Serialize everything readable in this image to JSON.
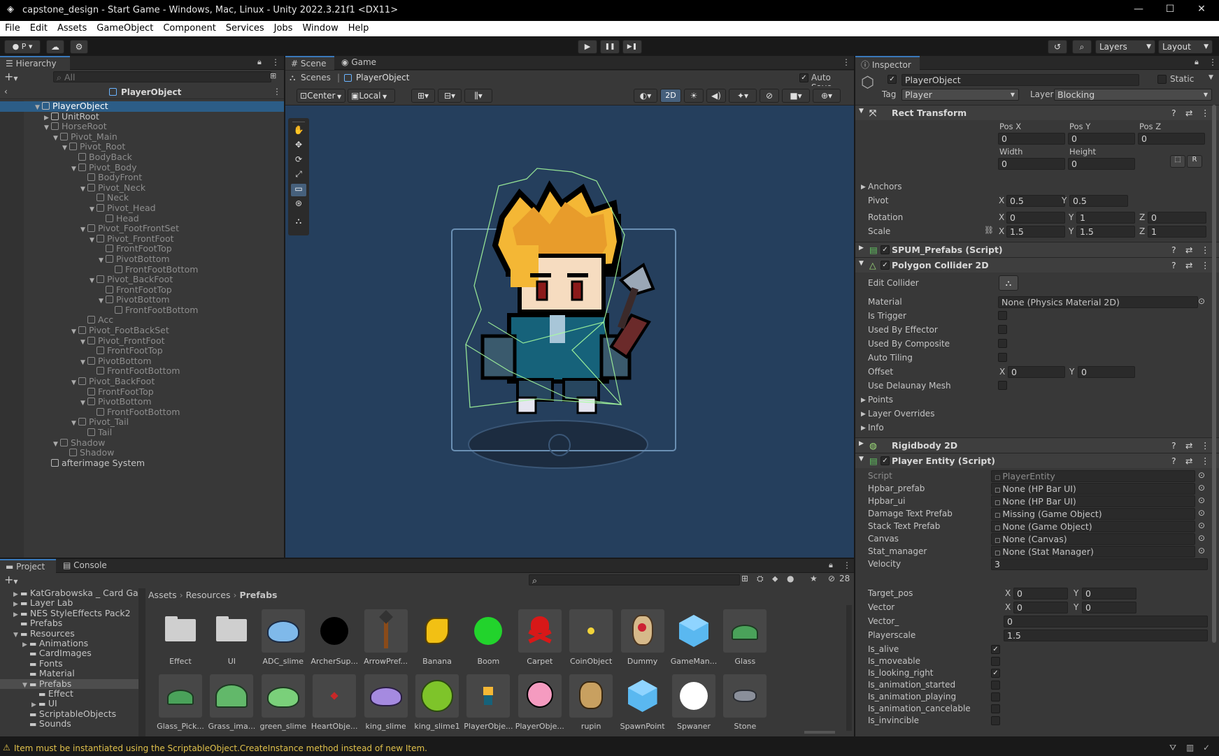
{
  "window": {
    "title": "capstone_design - Start Game - Windows, Mac, Linux - Unity 2022.3.21f1 <DX11>",
    "min": "—",
    "max": "☐",
    "close": "✕"
  },
  "menu": [
    "File",
    "Edit",
    "Assets",
    "GameObject",
    "Component",
    "Services",
    "Jobs",
    "Window",
    "Help"
  ],
  "toolbar": {
    "account": "P ▾",
    "play": "▶",
    "pause": "❚❚",
    "step": "▶❚",
    "layers": "Layers",
    "layout": "Layout"
  },
  "hierarchy": {
    "tab": "Hierarchy",
    "search_placeholder": "All",
    "breadcrumb": "PlayerObject",
    "rows": [
      {
        "label": "PlayerObject",
        "depth": 0,
        "arrow": "▼",
        "selected": true,
        "dim": false
      },
      {
        "label": "UnitRoot",
        "depth": 1,
        "arrow": "▶",
        "selected": false,
        "dim": false
      },
      {
        "label": "HorseRoot",
        "depth": 1,
        "arrow": "▼",
        "selected": false,
        "dim": true
      },
      {
        "label": "Pivot_Main",
        "depth": 2,
        "arrow": "▼",
        "selected": false,
        "dim": true
      },
      {
        "label": "Pivot_Root",
        "depth": 3,
        "arrow": "▼",
        "selected": false,
        "dim": true
      },
      {
        "label": "BodyBack",
        "depth": 4,
        "arrow": "",
        "selected": false,
        "dim": true
      },
      {
        "label": "Pivot_Body",
        "depth": 4,
        "arrow": "▼",
        "selected": false,
        "dim": true
      },
      {
        "label": "BodyFront",
        "depth": 5,
        "arrow": "",
        "selected": false,
        "dim": true
      },
      {
        "label": "Pivot_Neck",
        "depth": 5,
        "arrow": "▼",
        "selected": false,
        "dim": true
      },
      {
        "label": "Neck",
        "depth": 6,
        "arrow": "",
        "selected": false,
        "dim": true
      },
      {
        "label": "Pivot_Head",
        "depth": 6,
        "arrow": "▼",
        "selected": false,
        "dim": true
      },
      {
        "label": "Head",
        "depth": 7,
        "arrow": "",
        "selected": false,
        "dim": true
      },
      {
        "label": "Pivot_FootFrontSet",
        "depth": 5,
        "arrow": "▼",
        "selected": false,
        "dim": true
      },
      {
        "label": "Pivot_FrontFoot",
        "depth": 6,
        "arrow": "▼",
        "selected": false,
        "dim": true
      },
      {
        "label": "FrontFootTop",
        "depth": 7,
        "arrow": "",
        "selected": false,
        "dim": true
      },
      {
        "label": "PivotBottom",
        "depth": 7,
        "arrow": "▼",
        "selected": false,
        "dim": true
      },
      {
        "label": "FrontFootBottom",
        "depth": 8,
        "arrow": "",
        "selected": false,
        "dim": true
      },
      {
        "label": "Pivot_BackFoot",
        "depth": 6,
        "arrow": "▼",
        "selected": false,
        "dim": true
      },
      {
        "label": "FrontFootTop",
        "depth": 7,
        "arrow": "",
        "selected": false,
        "dim": true
      },
      {
        "label": "PivotBottom",
        "depth": 7,
        "arrow": "▼",
        "selected": false,
        "dim": true
      },
      {
        "label": "FrontFootBottom",
        "depth": 8,
        "arrow": "",
        "selected": false,
        "dim": true
      },
      {
        "label": "Acc",
        "depth": 5,
        "arrow": "",
        "selected": false,
        "dim": true
      },
      {
        "label": "Pivot_FootBackSet",
        "depth": 4,
        "arrow": "▼",
        "selected": false,
        "dim": true
      },
      {
        "label": "Pivot_FrontFoot",
        "depth": 5,
        "arrow": "▼",
        "selected": false,
        "dim": true
      },
      {
        "label": "FrontFootTop",
        "depth": 6,
        "arrow": "",
        "selected": false,
        "dim": true
      },
      {
        "label": "PivotBottom",
        "depth": 5,
        "arrow": "▼",
        "selected": false,
        "dim": true
      },
      {
        "label": "FrontFootBottom",
        "depth": 6,
        "arrow": "",
        "selected": false,
        "dim": true
      },
      {
        "label": "Pivot_BackFoot",
        "depth": 4,
        "arrow": "▼",
        "selected": false,
        "dim": true
      },
      {
        "label": "FrontFootTop",
        "depth": 5,
        "arrow": "",
        "selected": false,
        "dim": true
      },
      {
        "label": "PivotBottom",
        "depth": 5,
        "arrow": "▼",
        "selected": false,
        "dim": true
      },
      {
        "label": "FrontFootBottom",
        "depth": 6,
        "arrow": "",
        "selected": false,
        "dim": true
      },
      {
        "label": "Pivot_Tail",
        "depth": 4,
        "arrow": "▼",
        "selected": false,
        "dim": true
      },
      {
        "label": "Tail",
        "depth": 5,
        "arrow": "",
        "selected": false,
        "dim": true
      },
      {
        "label": "Shadow",
        "depth": 2,
        "arrow": "▼",
        "selected": false,
        "dim": true
      },
      {
        "label": "Shadow",
        "depth": 3,
        "arrow": "",
        "selected": false,
        "dim": true
      },
      {
        "label": "afterimage System",
        "depth": 1,
        "arrow": "",
        "selected": false,
        "dim": false
      }
    ]
  },
  "scene": {
    "tab_scene": "Scene",
    "tab_game": "Game",
    "crumb_scenes": "Scenes",
    "crumb_obj": "PlayerObject",
    "autosave": "Auto Save",
    "pivot": "Center",
    "space": "Local",
    "mode2d": "2D"
  },
  "inspector": {
    "tab": "Inspector",
    "object_name": "PlayerObject",
    "static": "Static",
    "tag_label": "Tag",
    "tag": "Player",
    "layer_label": "Layer",
    "layer": "Blocking",
    "rect": {
      "title": "Rect Transform",
      "posx_l": "Pos X",
      "posy_l": "Pos Y",
      "posz_l": "Pos Z",
      "posx": "0",
      "posy": "0",
      "posz": "0",
      "width_l": "Width",
      "height_l": "Height",
      "width": "0",
      "height": "0",
      "r": "R",
      "anchors": "Anchors",
      "pivot": "Pivot",
      "pivot_x": "0.5",
      "pivot_y": "0.5",
      "rotation": "Rotation",
      "rot_x": "0",
      "rot_y": "1",
      "rot_z": "0",
      "scale": "Scale",
      "sc_x": "1.5",
      "sc_y": "1.5",
      "sc_z": "1",
      "x": "X",
      "y": "Y",
      "z": "Z"
    },
    "spum": "SPUM_Prefabs (Script)",
    "poly": {
      "title": "Polygon Collider 2D",
      "edit": "Edit Collider",
      "material_l": "Material",
      "material": "None (Physics Material 2D)",
      "is_trigger": "Is Trigger",
      "effector": "Used By Effector",
      "composite": "Used By Composite",
      "tiling": "Auto Tiling",
      "offset": "Offset",
      "off_x": "0",
      "off_y": "0",
      "delaunay": "Use Delaunay Mesh",
      "points": "Points",
      "layer_over": "Layer Overrides",
      "info": "Info"
    },
    "rigid": "Rigidbody 2D",
    "player": {
      "title": "Player Entity (Script)",
      "fields": [
        {
          "label": "Script",
          "value": "PlayerEntity",
          "kind": "obj",
          "dim": true
        },
        {
          "label": "Hpbar_prefab",
          "value": "None (HP Bar UI)",
          "kind": "obj",
          "dim": false
        },
        {
          "label": "Hpbar_ui",
          "value": "None (HP Bar UI)",
          "kind": "obj",
          "dim": false
        },
        {
          "label": "Damage Text Prefab",
          "value": "Missing (Game Object)",
          "kind": "obj",
          "dim": false
        },
        {
          "label": "Stack Text Prefab",
          "value": "None (Game Object)",
          "kind": "obj",
          "dim": false
        },
        {
          "label": "Canvas",
          "value": "None (Canvas)",
          "kind": "obj",
          "dim": false
        },
        {
          "label": "Stat_manager",
          "value": "None (Stat Manager)",
          "kind": "obj",
          "dim": false
        },
        {
          "label": "Velocity",
          "value": "3",
          "kind": "text",
          "dim": false
        }
      ],
      "target_pos": "Target_pos",
      "tp_x": "0",
      "tp_y": "0",
      "vector": "Vector",
      "v_x": "0",
      "v_y": "0",
      "vector_": "Vector_",
      "vector_val": "0",
      "playerscale": "Playerscale",
      "playerscale_val": "1.5",
      "bools": [
        {
          "label": "Is_alive",
          "checked": true
        },
        {
          "label": "Is_moveable",
          "checked": false
        },
        {
          "label": "Is_looking_right",
          "checked": true
        },
        {
          "label": "Is_animation_started",
          "checked": false
        },
        {
          "label": "Is_animation_playing",
          "checked": false
        },
        {
          "label": "Is_animation_cancelable",
          "checked": false
        },
        {
          "label": "Is_invincible",
          "checked": false
        }
      ]
    }
  },
  "project": {
    "tab_project": "Project",
    "tab_console": "Console",
    "count": "28",
    "tree": [
      {
        "label": "KatGrabowska _ Card Gan",
        "depth": 1,
        "arrow": "▶"
      },
      {
        "label": "Layer Lab",
        "depth": 1,
        "arrow": "▶"
      },
      {
        "label": "NES StyleEffects Pack2",
        "depth": 1,
        "arrow": "▶"
      },
      {
        "label": "Prefabs",
        "depth": 1,
        "arrow": ""
      },
      {
        "label": "Resources",
        "depth": 1,
        "arrow": "▼"
      },
      {
        "label": "Animations",
        "depth": 2,
        "arrow": "▶"
      },
      {
        "label": "CardImages",
        "depth": 2,
        "arrow": ""
      },
      {
        "label": "Fonts",
        "depth": 2,
        "arrow": ""
      },
      {
        "label": "Material",
        "depth": 2,
        "arrow": ""
      },
      {
        "label": "Prefabs",
        "depth": 2,
        "arrow": "▼"
      },
      {
        "label": "Effect",
        "depth": 3,
        "arrow": ""
      },
      {
        "label": "UI",
        "depth": 3,
        "arrow": "▶"
      },
      {
        "label": "ScriptableObjects",
        "depth": 2,
        "arrow": ""
      },
      {
        "label": "Sounds",
        "depth": 2,
        "arrow": ""
      }
    ],
    "path": [
      "Assets",
      "Resources",
      "Prefabs"
    ],
    "assets_row1": [
      {
        "label": "Effect",
        "kind": "folder"
      },
      {
        "label": "UI",
        "kind": "folder"
      },
      {
        "label": "ADC_slime",
        "kind": "blueslime"
      },
      {
        "label": "ArcherSup...",
        "kind": "black"
      },
      {
        "label": "ArrowPref...",
        "kind": "arrow"
      },
      {
        "label": "Banana",
        "kind": "banana"
      },
      {
        "label": "Boom",
        "kind": "green"
      },
      {
        "label": "Carpet",
        "kind": "skull"
      },
      {
        "label": "CoinObject",
        "kind": "coin"
      },
      {
        "label": "Dummy",
        "kind": "dummy"
      },
      {
        "label": "GameMan...",
        "kind": "cube"
      },
      {
        "label": "Glass",
        "kind": "grass"
      }
    ],
    "assets_row2": [
      {
        "label": "Glass_Pick...",
        "kind": "grass"
      },
      {
        "label": "Grass_ima...",
        "kind": "grass2"
      },
      {
        "label": "green_slime",
        "kind": "gslime"
      },
      {
        "label": "HeartObje...",
        "kind": "heart"
      },
      {
        "label": "king_slime",
        "kind": "pslime"
      },
      {
        "label": "king_slime1",
        "kind": "kslime"
      },
      {
        "label": "PlayerObje...",
        "kind": "player"
      },
      {
        "label": "PlayerObje...",
        "kind": "kirby"
      },
      {
        "label": "rupin",
        "kind": "monkey"
      },
      {
        "label": "SpawnPoint",
        "kind": "cube"
      },
      {
        "label": "Spwaner",
        "kind": "white"
      },
      {
        "label": "Stone",
        "kind": "stone"
      }
    ]
  },
  "status": {
    "message": "Item must be instantiated using the ScriptableObject.CreateInstance method instead of new Item."
  },
  "colors": {
    "accent": "#3a79bb",
    "selection": "#2c5d87",
    "viewport": "#253f5d",
    "collider": "#a8ff9f"
  }
}
